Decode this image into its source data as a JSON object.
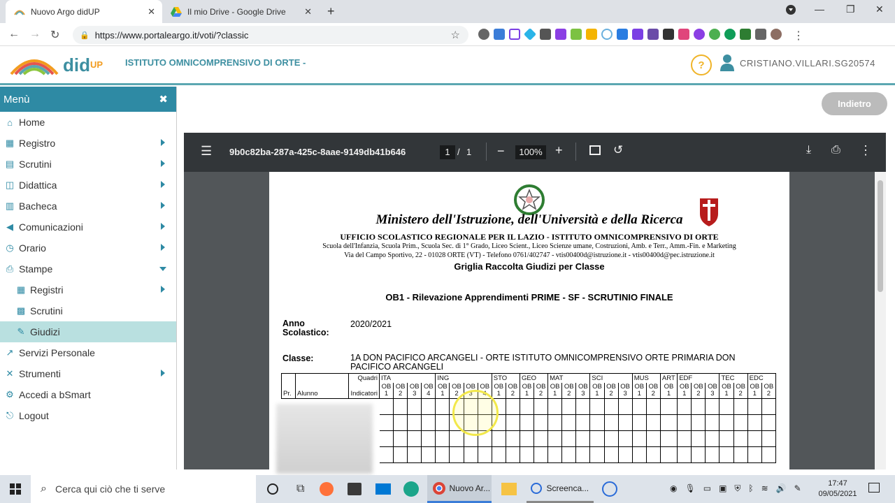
{
  "browser": {
    "tabs": [
      {
        "title": "Nuovo Argo didUP",
        "active": true
      },
      {
        "title": "Il mio Drive - Google Drive",
        "active": false
      }
    ],
    "url": "https://www.portaleargo.it/voti/?classic"
  },
  "header": {
    "logo_text": "did",
    "logo_sup": "UP",
    "school": "ISTITUTO OMNICOMPRENSIVO DI ORTE -",
    "help": "?",
    "user": "CRISTIANO.VILLARI.SG20574"
  },
  "sidebar": {
    "title": "Menù",
    "close": "✖",
    "items": [
      {
        "label": "Home",
        "icon": "home-icon"
      },
      {
        "label": "Registro",
        "icon": "calendar-icon"
      },
      {
        "label": "Scrutini",
        "icon": "clipboard-icon"
      },
      {
        "label": "Didattica",
        "icon": "book-icon"
      },
      {
        "label": "Bacheca",
        "icon": "board-icon"
      },
      {
        "label": "Comunicazioni",
        "icon": "megaphone-icon"
      },
      {
        "label": "Orario",
        "icon": "clock-icon"
      },
      {
        "label": "Stampe",
        "icon": "print-icon"
      },
      {
        "label": "Registri",
        "icon": "calendar-icon"
      },
      {
        "label": "Scrutini",
        "icon": "grid-icon"
      },
      {
        "label": "Giudizi",
        "icon": "edit-icon"
      },
      {
        "label": "Servizi Personale",
        "icon": "share-icon"
      },
      {
        "label": "Strumenti",
        "icon": "tools-icon"
      },
      {
        "label": "Accedi a bSmart",
        "icon": "gear-icon"
      },
      {
        "label": "Logout",
        "icon": "logout-icon"
      }
    ]
  },
  "back_button": "Indietro",
  "pdf": {
    "filename": "9b0c82ba-287a-425c-8aae-9149db41b646",
    "page": "1",
    "sep": "/",
    "pages": "1",
    "zoom": "100%",
    "ministry": "Ministero dell'Istruzione, dell'Università e della Ricerca",
    "office": "UFFICIO SCOLASTICO REGIONALE PER IL LAZIO - ISTITUTO OMNICOMPRENSIVO DI ORTE",
    "schools": "Scuola dell'Infanzia, Scuola Prim., Scuola Sec. di 1° Grado, Liceo Scient., Liceo Scienze umane, Costruzioni, Amb. e Terr., Amm.-Fin. e Marketing",
    "address": "Via del Campo Sportivo, 22 - 01028 ORTE (VT) - Telefono 0761/402747 - vtis00400d@istruzione.it - vtis00400d@pec.istruzione.it",
    "doc_title": "Griglia Raccolta Giudizi per Classe",
    "report_title": "OB1 - Rilevazione Apprendimenti PRIME - SF - SCRUTINIO FINALE",
    "anno_label": "Anno Scolastico:",
    "anno_value": "2020/2021",
    "classe_label": "Classe:",
    "classe_value": "1A DON PACIFICO ARCANGELI - ORTE ISTITUTO OMNICOMPRENSIVO ORTE PRIMARIA DON PACIFICO ARCANGELI",
    "table": {
      "quadri": "Quadri",
      "indicatori": "Indicatori",
      "pr": "Pr.",
      "alunno": "Alunno",
      "subjects": [
        {
          "name": "ITA",
          "obs": [
            "OB 1",
            "OB 2",
            "OB 3",
            "OB 4"
          ]
        },
        {
          "name": "ING",
          "obs": [
            "OB 1",
            "OB 2",
            "OB 3",
            "OB 4"
          ]
        },
        {
          "name": "STO",
          "obs": [
            "OB 1",
            "OB 2"
          ]
        },
        {
          "name": "GEO",
          "obs": [
            "OB 1",
            "OB 2"
          ]
        },
        {
          "name": "MAT",
          "obs": [
            "OB 1",
            "OB 2",
            "OB 3"
          ]
        },
        {
          "name": "SCI",
          "obs": [
            "OB 1",
            "OB 2",
            "OB 3"
          ]
        },
        {
          "name": "MUS",
          "obs": [
            "OB 1",
            "OB 2"
          ]
        },
        {
          "name": "ART",
          "obs": [
            "OB 1"
          ]
        },
        {
          "name": "EDF",
          "obs": [
            "OB 1",
            "OB 2",
            "OB 3"
          ]
        },
        {
          "name": "TEC",
          "obs": [
            "OB 1",
            "OB 2"
          ]
        },
        {
          "name": "EDC",
          "obs": [
            "OB 1",
            "OB 2"
          ]
        }
      ]
    }
  },
  "taskbar": {
    "search": "Cerca qui ciò che ti serve",
    "apps": [
      "Nuovo Ar...",
      "Screenca..."
    ],
    "time": "17:47",
    "date": "09/05/2021"
  }
}
